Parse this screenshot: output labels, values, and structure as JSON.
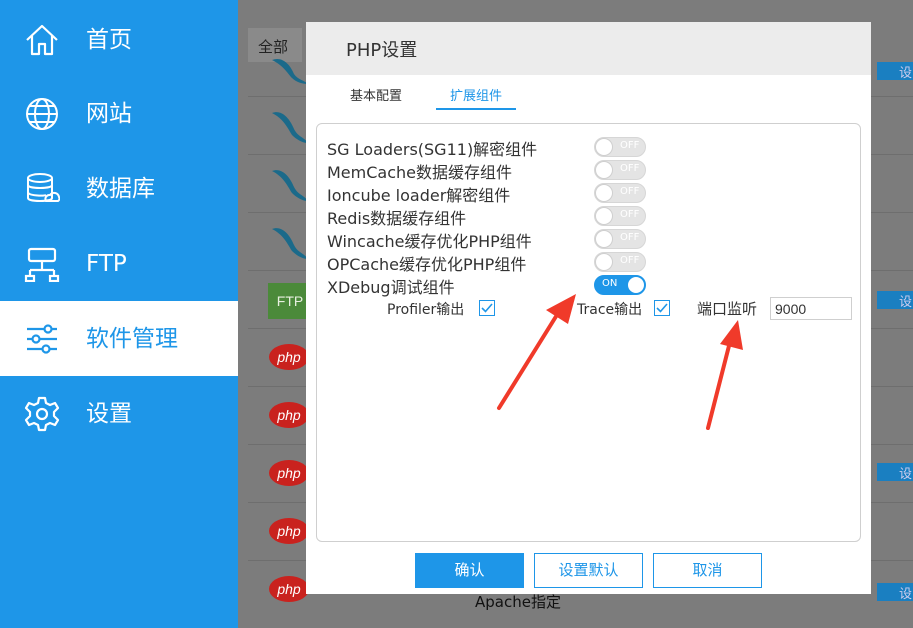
{
  "sidebar": {
    "items": [
      {
        "label": "首页",
        "icon": "home-icon"
      },
      {
        "label": "网站",
        "icon": "globe-icon"
      },
      {
        "label": "数据库",
        "icon": "database-icon"
      },
      {
        "label": "FTP",
        "icon": "ftp-icon"
      },
      {
        "label": "软件管理",
        "icon": "sliders-icon",
        "active": true
      },
      {
        "label": "设置",
        "icon": "gear-icon"
      }
    ]
  },
  "background": {
    "tab_all": "全部",
    "buttons": [
      "设",
      "设",
      "设",
      "设"
    ],
    "footer_label": "Apache指定",
    "row_icons": [
      "mysql-icon",
      "mysql-icon",
      "mysql-icon",
      "mysql-icon",
      "ftp-icon",
      "php-icon",
      "php-icon",
      "php-icon",
      "php-icon",
      "php-icon"
    ],
    "ftp_badge": "FTP",
    "php_badge": "php"
  },
  "dialog": {
    "title": "PHP设置",
    "tabs": [
      {
        "label": "基本配置",
        "active": false
      },
      {
        "label": "扩展组件",
        "active": true
      }
    ],
    "extensions": [
      {
        "label": "SG Loaders(SG11)解密组件",
        "state": "OFF"
      },
      {
        "label": "MemCache数据缓存组件",
        "state": "OFF"
      },
      {
        "label": "Ioncube loader解密组件",
        "state": "OFF"
      },
      {
        "label": "Redis数据缓存组件",
        "state": "OFF"
      },
      {
        "label": "Wincache缓存优化PHP组件",
        "state": "OFF"
      },
      {
        "label": "OPCache缓存优化PHP组件",
        "state": "OFF"
      },
      {
        "label": "XDebug调试组件",
        "state": "ON"
      }
    ],
    "xdebug": {
      "profiler_label": "Profiler输出",
      "profiler_checked": true,
      "trace_label": "Trace输出",
      "trace_checked": true,
      "port_label": "端口监听",
      "port_value": "9000"
    },
    "buttons": {
      "confirm": "确认",
      "set_default": "设置默认",
      "cancel": "取消"
    }
  },
  "colors": {
    "accent": "#1e96e8",
    "annotation": "#f03a2a",
    "php_badge": "#d9231f",
    "mysql_logo": "#1b6a8a"
  }
}
